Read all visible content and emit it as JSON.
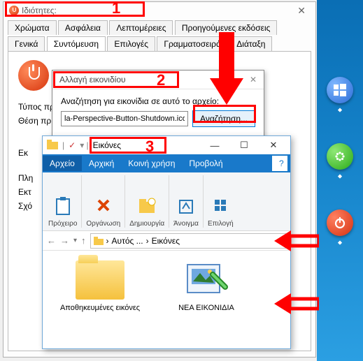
{
  "props": {
    "title": "Ιδιότητες:",
    "close": "✕",
    "tabs_row1": [
      "Χρώματα",
      "Ασφάλεια",
      "Λεπτομέρειες",
      "Προηγούμενες εκδόσεις"
    ],
    "tabs_row2": [
      "Γενικά",
      "Συντόμευση",
      "Επιλογές",
      "Γραμματοσειρά",
      "Διάταξη"
    ],
    "active_tab": "Συντόμευση",
    "labels": {
      "type": "Τύπος προ",
      "location": "Θέση πρ",
      "run": "Εκ",
      "comment": "Πλη",
      "hotkey": "Εκτ",
      "note": "Σχό"
    }
  },
  "change_icon": {
    "title": "Αλλαγή εικονιδίου",
    "prompt": "Αναζήτηση για εικονίδια σε αυτό το αρχείο:",
    "file": "la-Perspective-Button-Shutdown.ico",
    "browse": "Αναζήτηση..."
  },
  "explorer": {
    "title": "Εικόνες",
    "menu": {
      "file": "Αρχείο",
      "home": "Αρχική",
      "share": "Κοινή χρήση",
      "view": "Προβολή",
      "help": "?"
    },
    "ribbon": [
      "Πρόχειρο",
      "Οργάνωση",
      "Δημιουργία",
      "Άνοιγμα",
      "Επιλογή"
    ],
    "nav": {
      "back": "←",
      "fwd": "→",
      "up": "↑"
    },
    "path": [
      "Αυτός ...",
      "Εικόνες"
    ],
    "items": [
      {
        "name": "Αποθηκευμένες εικόνες"
      },
      {
        "name": "ΝΕΑ ΕΙΚΟΝΙΔΙΑ"
      }
    ],
    "win": {
      "min": "—",
      "max": "☐",
      "close": "✕"
    }
  },
  "desktop": {
    "icons": [
      "windows",
      "lock",
      "power-green",
      "power-red"
    ]
  },
  "annotations": {
    "n1": "1",
    "n2": "2",
    "n3": "3"
  }
}
